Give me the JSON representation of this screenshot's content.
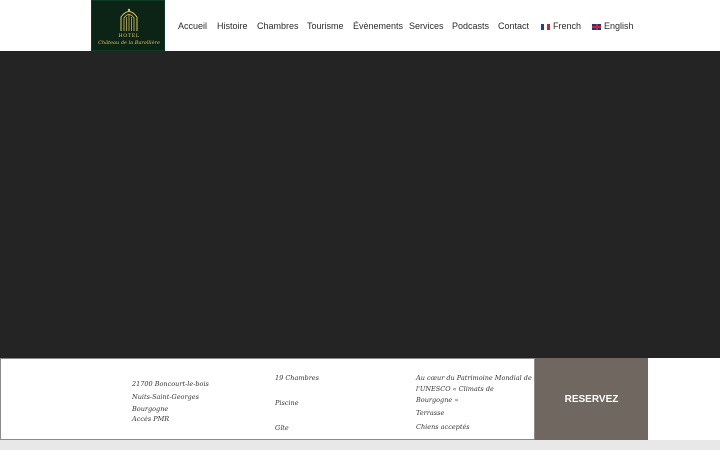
{
  "logo": {
    "line1": "HOTEL",
    "line2": "Château de la Barollière",
    "icon": "arched-gate-icon"
  },
  "nav": {
    "items": [
      "Accueil",
      "Histoire",
      "Chambres",
      "Tourisme",
      "Évènements",
      "Services",
      "Podcasts",
      "Contact"
    ],
    "lang_french": "French",
    "lang_english": "English"
  },
  "info": {
    "address": [
      "21700 Boncourt-le-bois",
      "Nuits-Saint-Georges",
      "Bourgogne",
      "Accès PMR"
    ],
    "features": [
      "19 Chambres",
      "Piscine",
      "Gîte"
    ],
    "heritage": [
      "Au cœur du Patrimoine Mondial de",
      "l'UNESCO « Climats de",
      "Bourgogne »",
      "Terrasse",
      "Chiens acceptés"
    ]
  },
  "reserve_label": "RESERVEZ",
  "colors": {
    "logo_bg": "#0b2416",
    "logo_gold": "#e4c655",
    "hero_bg": "#242424",
    "reserve_bg": "#6f6760"
  }
}
